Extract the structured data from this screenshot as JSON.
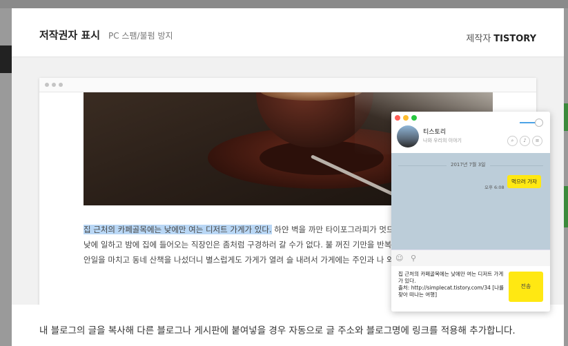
{
  "modal": {
    "title": "저작권자 표시",
    "subtitle": "PC 스팸/불펌 방지",
    "maker_label": "제작자",
    "maker_name": "TISTORY"
  },
  "article": {
    "highlighted": "집 근처의 카페골목에는 낮에만 여는 디저트 가게가 있다.",
    "rest": " 하얀 벽을 까만 타이포그라피가 멋드러지게 띄는 가게였다. 낮에 일하고 밤에 집에 들어오는 직장인은 좀처럼 구경하러 갈 수가 없다. 불 꺼진 기만을 반복하던 어느 주말, 밀린 집안일을 마치고 동네 산책을 나섰더니 별스럽게도 가게가 열려 슬 내려서 가게에는 주인과 나 외에는 아무도 없었다."
  },
  "chat": {
    "name": "티스토리",
    "status": "나와 우리의 이야기",
    "date": "2017년 7월 3일",
    "time": "오후 6:08",
    "message": "먹으러 가자",
    "input_text": "집 근처의 카페골목에는 낮에만 여는 디저트 가게가 있다.\n출처: http://simplecat.tistory.com/34 [나를 찾아 떠나는 여행]",
    "send_label": "전송",
    "colors": {
      "bubble": "#ffe812",
      "body_bg": "#bccdd9"
    },
    "icons": [
      "search-icon",
      "bell-icon",
      "menu-icon",
      "emoticon-icon",
      "attach-icon"
    ]
  },
  "footer": {
    "text": "내 블로그의 글을 복사해 다른 블로그나 게시판에 붙여넣을 경우 자동으로 글 주소와 블로그명에 링크를 적용해 추가합니다."
  }
}
